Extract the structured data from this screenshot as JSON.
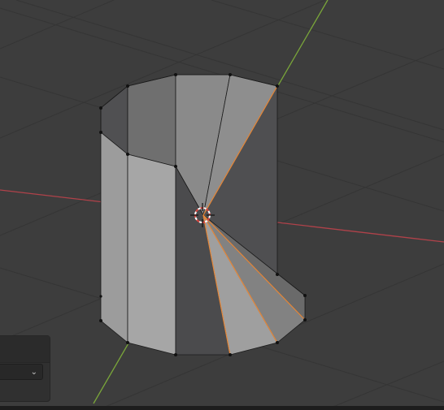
{
  "viewport": {
    "background": "#3d3d3d",
    "grid_color": "#353535",
    "x_axis_color": "#b0424a",
    "y_axis_color": "#7aa63a",
    "selection_color": "#e8893a",
    "vertex_color": "#111111"
  },
  "mesh": {
    "object": "cylinder",
    "face_colors": {
      "light": "#a3a3a3",
      "mid": "#8a8a8a",
      "dark": "#4b4b4d",
      "inner": "#6e6e6e"
    }
  },
  "cursor": {
    "icon": "3d-cursor-icon"
  },
  "redo_panel": {
    "title": "",
    "dropdown_value": "",
    "chevron_icon": "chevron-down-icon"
  }
}
